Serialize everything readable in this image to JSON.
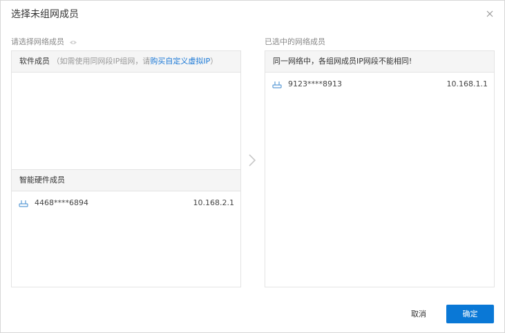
{
  "dialog": {
    "title": "选择未组网成员",
    "close_icon": "close-icon"
  },
  "left": {
    "label": "请选择网络成员",
    "hint_icon": "eye-icon",
    "software": {
      "title": "软件成员",
      "note_prefix": "（如需使用同网段IP组网，请",
      "link": "购买自定义虚拟IP",
      "note_suffix": "）"
    },
    "hardware": {
      "title": "智能硬件成员",
      "members": [
        {
          "id": "4468****6894",
          "ip": "10.168.2.1",
          "icon": "router-icon"
        }
      ]
    }
  },
  "right": {
    "label": "已选中的网络成员",
    "header": "同一网络中，各组网成员IP网段不能相同!",
    "members": [
      {
        "id": "9123****8913",
        "ip": "10.168.1.1",
        "icon": "router-icon"
      }
    ]
  },
  "transfer_icon": "chevron-right-icon",
  "buttons": {
    "cancel": "取消",
    "ok": "确定"
  },
  "colors": {
    "primary": "#0a78d6",
    "link": "#1a78d6",
    "icon": "#5b9bd5"
  }
}
